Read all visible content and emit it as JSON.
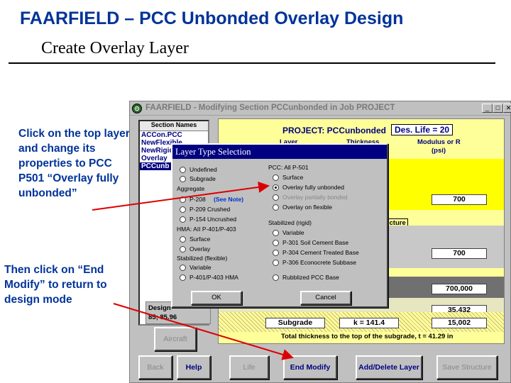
{
  "slide": {
    "title": "FAARFIELD – PCC Unbonded Overlay Design",
    "subtitle": "Create Overlay Layer",
    "note_1": "Click on the top layer and change its properties to PCC P501 “Overlay fully unbonded”",
    "note_2": "Then click on “End Modify” to return to design mode"
  },
  "window": {
    "title": "FAARFIELD - Modifying Section PCCunbonded in Job PROJECT",
    "min_label": "_",
    "max_label": "□",
    "close_label": "✕"
  },
  "section_list": {
    "header": "Section Names",
    "items": [
      "ACCon.PCC",
      "NewFlexible",
      "NewRigid",
      "Overlay",
      "PCCunb"
    ],
    "selected_index": 4
  },
  "design_box": {
    "label": "Design",
    "values": "85;  85.96"
  },
  "header_area": {
    "project": "PROJECT: PCCunbonded",
    "des_life": "Des. Life = 20",
    "col_layer": "Layer",
    "col_thickness": "Thickness",
    "col_modulus": "Modulus or R",
    "col_modulus_unit": "(psi)"
  },
  "layers": {
    "row1_modulus": "700",
    "structure_btn": "ructure",
    "row2_modulus": "700",
    "row3_modulus": "700,000",
    "row4_modulus": "35,432",
    "subgrade_label": "Subgrade",
    "subgrade_k": "k = 141.4",
    "subgrade_modulus": "15,002",
    "total_text": "Total thickness to the top of the subgrade, t = 41.29 in"
  },
  "buttons": {
    "aircraft": "Aircraft",
    "back": "Back",
    "help": "Help",
    "life": "Life",
    "end_modify": "End Modify",
    "add_delete": "Add/Delete Layer",
    "save_structure": "Save Structure"
  },
  "dialog": {
    "title": "Layer Type Selection",
    "left_options": [
      "Undefined",
      "Subgrade"
    ],
    "aggregate_label": "Aggregate",
    "aggregate_options": [
      "P-208",
      "P-209 Crushed",
      "P-154 Uncrushed"
    ],
    "see_note": "(See Note)",
    "hma_label": "HMA: AII P-401/P-403",
    "hma_options": [
      "Surface",
      "Overlay"
    ],
    "stab_flex_label": "Stabilized (flexible)",
    "stab_flex_options": [
      "Variable",
      "P-401/P-403 HMA"
    ],
    "pcc_label": "PCC: All P-501",
    "pcc_options": [
      "Surface",
      "Overlay fully unbonded",
      "Overlay partially bonded",
      "Overlay on flexible"
    ],
    "stab_rigid_label": "Stabilized (rigid)",
    "stab_rigid_options": [
      "Variable",
      "P-301 Soil Cement Base",
      "P-304 Cement Treated Base",
      "P-306 Econocrete Subbase"
    ],
    "rubblized": "Rubblized PCC Base",
    "ok": "OK",
    "cancel": "Cancel"
  },
  "colors": {
    "accent": "#003399",
    "panel": "#ffff99",
    "arrow": "#dd0000",
    "titlebar_dialog": "#000080"
  }
}
